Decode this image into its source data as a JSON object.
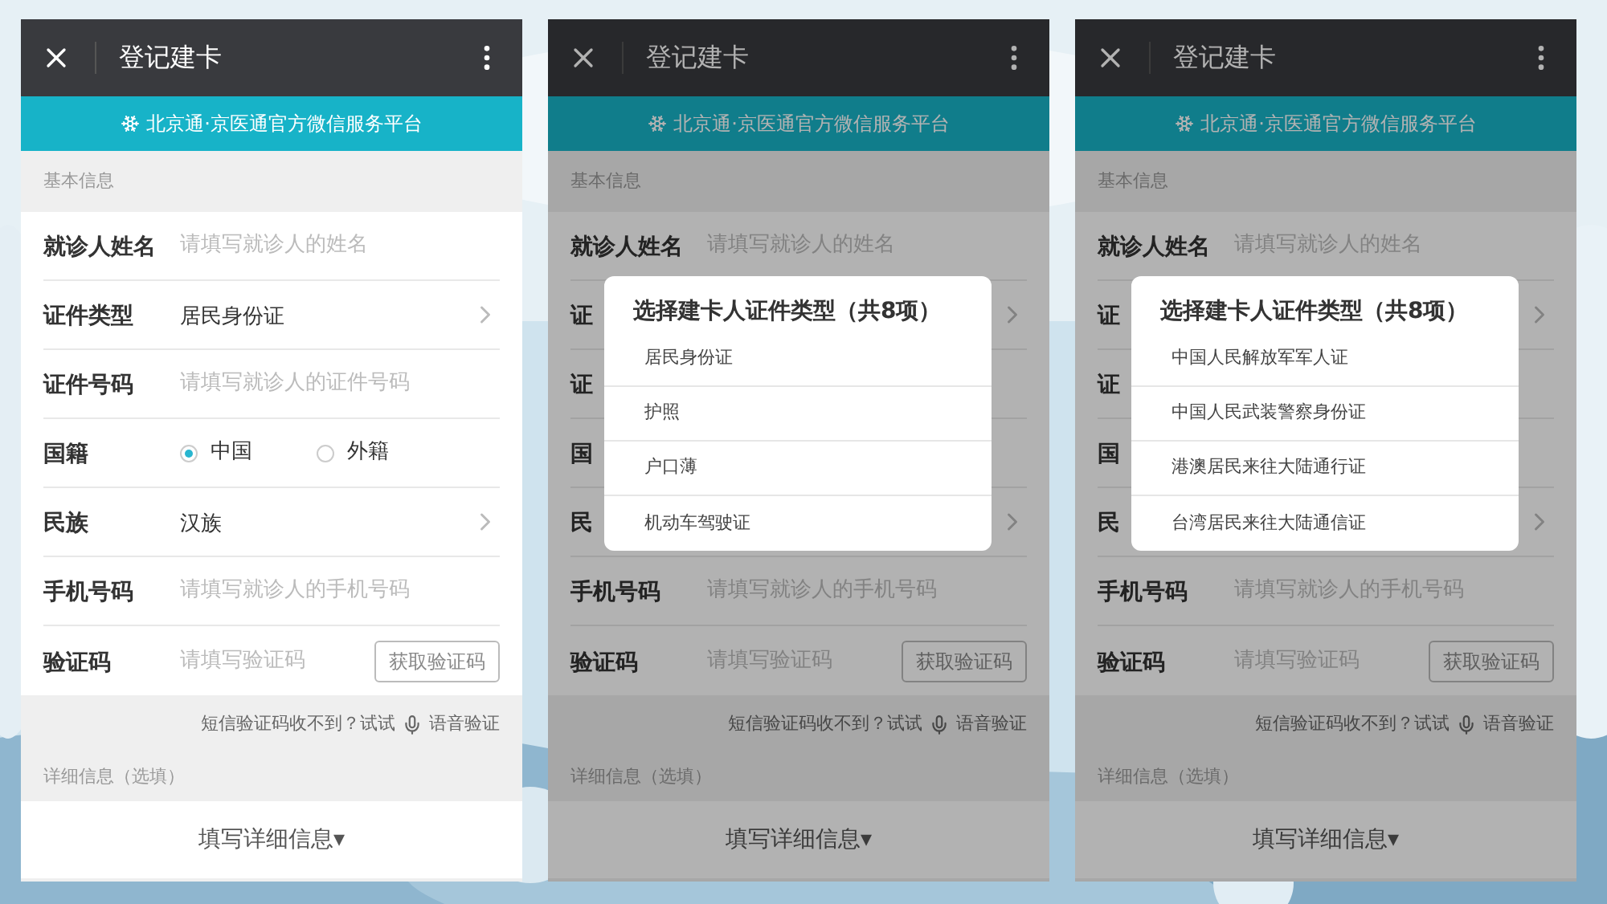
{
  "phones": [
    {
      "title": "登记建卡",
      "banner": "北京通·京医通官方微信服务平台",
      "section_label": "基本信息",
      "dimmed": false,
      "fields": [
        {
          "kind": "input",
          "label": "就诊人姓名",
          "placeholder": "请填写就诊人的姓名"
        },
        {
          "kind": "select",
          "label": "证件类型",
          "value": "居民身份证"
        },
        {
          "kind": "input",
          "label": "证件号码",
          "placeholder": "请填写就诊人的证件号码"
        },
        {
          "kind": "radio",
          "label": "国籍",
          "options": [
            {
              "label": "中国",
              "selected": true
            },
            {
              "label": "外籍",
              "selected": false
            }
          ]
        },
        {
          "kind": "select",
          "label": "民族",
          "value": "汉族"
        },
        {
          "kind": "input",
          "label": "手机号码",
          "placeholder": "请填写就诊人的手机号码"
        },
        {
          "kind": "code",
          "label": "验证码",
          "placeholder": "请填写验证码",
          "button": "获取验证码"
        }
      ],
      "sms_hint": "短信验证码收不到？试试",
      "voice_link": "语音验证",
      "detail_label": "详细信息（选填）",
      "detail_button": "填写详细信息▾"
    },
    {
      "title": "登记建卡",
      "banner": "北京通·京医通官方微信服务平台",
      "section_label": "基本信息",
      "dimmed": true,
      "fields": [
        {
          "kind": "input",
          "label": "就诊人姓名",
          "placeholder": "请填写就诊人的姓名"
        },
        {
          "kind": "select",
          "label": "证"
        },
        {
          "kind": "input",
          "label": "证"
        },
        {
          "kind": "radio",
          "label": "国"
        },
        {
          "kind": "select",
          "label": "民"
        },
        {
          "kind": "input",
          "label": "手机号码",
          "placeholder": "请填写就诊人的手机号码"
        },
        {
          "kind": "code",
          "label": "验证码",
          "placeholder": "请填写验证码",
          "button": "获取验证码"
        }
      ],
      "sms_hint": "短信验证码收不到？试试",
      "voice_link": "语音验证",
      "detail_label": "详细信息（选填）",
      "detail_button": "填写详细信息▾",
      "dialog": {
        "title": "选择建卡人证件类型（共8项）",
        "options": [
          "居民身份证",
          "护照",
          "户口薄",
          "机动车驾驶证"
        ]
      }
    },
    {
      "title": "登记建卡",
      "banner": "北京通·京医通官方微信服务平台",
      "section_label": "基本信息",
      "dimmed": true,
      "fields": [
        {
          "kind": "input",
          "label": "就诊人姓名",
          "placeholder": "请填写就诊人的姓名"
        },
        {
          "kind": "select",
          "label": "证"
        },
        {
          "kind": "input",
          "label": "证"
        },
        {
          "kind": "radio",
          "label": "国"
        },
        {
          "kind": "select",
          "label": "民"
        },
        {
          "kind": "input",
          "label": "手机号码",
          "placeholder": "请填写就诊人的手机号码"
        },
        {
          "kind": "code",
          "label": "验证码",
          "placeholder": "请填写验证码",
          "button": "获取验证码"
        }
      ],
      "sms_hint": "短信验证码收不到？试试",
      "voice_link": "语音验证",
      "detail_label": "详细信息（选填）",
      "detail_button": "填写详细信息▾",
      "dialog": {
        "title": "选择建卡人证件类型（共8项）",
        "options": [
          "中国人民解放军军人证",
          "中国人民武装警察身份证",
          "港澳居民来往大陆通行证",
          "台湾居民来往大陆通信证"
        ]
      }
    }
  ]
}
